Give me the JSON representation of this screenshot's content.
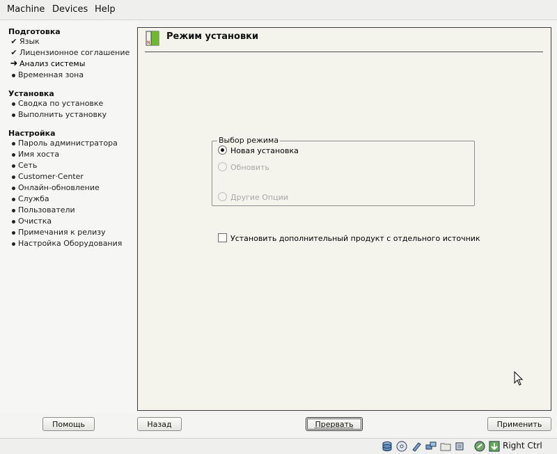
{
  "menubar": {
    "machine": "Machine",
    "devices": "Devices",
    "help": "Help"
  },
  "sidebar": {
    "sections": [
      {
        "title": "Подготовка",
        "items": [
          {
            "label": "Язык",
            "state": "done"
          },
          {
            "label": "Лицензионное соглашение",
            "state": "done"
          },
          {
            "label": "Анализ системы",
            "state": "current"
          },
          {
            "label": "Временная зона",
            "state": "todo"
          }
        ]
      },
      {
        "title": "Установка",
        "items": [
          {
            "label": "Сводка по установке",
            "state": "todo"
          },
          {
            "label": "Выполнить установку",
            "state": "todo"
          }
        ]
      },
      {
        "title": "Настройка",
        "items": [
          {
            "label": "Пароль администратора",
            "state": "todo"
          },
          {
            "label": "Имя хоста",
            "state": "todo"
          },
          {
            "label": "Сеть",
            "state": "todo"
          },
          {
            "label": "Customer·Center",
            "state": "todo"
          },
          {
            "label": "Онлайн-обновление",
            "state": "todo"
          },
          {
            "label": "Служба",
            "state": "todo"
          },
          {
            "label": "Пользователи",
            "state": "todo"
          },
          {
            "label": "Очистка",
            "state": "todo"
          },
          {
            "label": "Примечания к релизу",
            "state": "todo"
          },
          {
            "label": "Настройка Оборудования",
            "state": "todo"
          }
        ]
      }
    ]
  },
  "main": {
    "title": "Режим установки",
    "mode_group": {
      "title": "Выбор режима",
      "options": [
        {
          "label": "Новая установка",
          "checked": true,
          "enabled": true
        },
        {
          "label": "Обновить",
          "checked": false,
          "enabled": false
        },
        {
          "label": "Другие Опции",
          "checked": false,
          "enabled": false
        }
      ]
    },
    "addon_checkbox": {
      "label": "Установить дополнительный продукт с отдельного источник",
      "checked": false
    }
  },
  "buttons": {
    "help": "Помощь",
    "back": "Назад",
    "abort": "Прервать",
    "accept": "Применить"
  },
  "statusbar": {
    "host_key": "Right Ctrl"
  },
  "colors": {
    "accent_green": "#6dbb2c",
    "panel_bg": "#f4f4ec"
  }
}
